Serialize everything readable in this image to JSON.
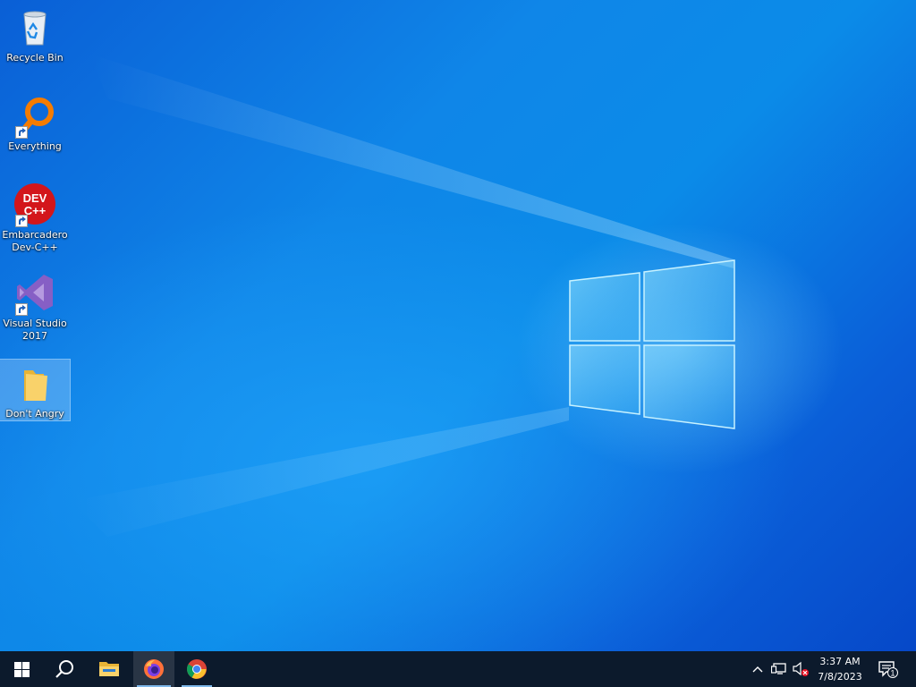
{
  "desktop": {
    "icons": [
      {
        "label": "Recycle Bin",
        "icon": "recycle-bin-icon"
      },
      {
        "label": "Everything",
        "icon": "everything-search-icon"
      },
      {
        "label": "Embarcadero\nDev-C++",
        "icon": "dev-cpp-icon",
        "badge_text": "DEV\nC++"
      },
      {
        "label": "Visual Studio\n2017",
        "icon": "visual-studio-icon"
      },
      {
        "label": "Don't Angry",
        "icon": "folder-icon"
      }
    ]
  },
  "taskbar": {
    "start": "start-icon",
    "search": "search-icon",
    "apps": [
      {
        "name": "File Explorer",
        "icon": "file-explorer-icon"
      },
      {
        "name": "Firefox",
        "icon": "firefox-icon"
      },
      {
        "name": "Chrome",
        "icon": "chrome-icon"
      }
    ],
    "tray": {
      "time": "3:37 AM",
      "date": "7/8/2023",
      "notification_count": "1"
    }
  },
  "colors": {
    "taskbar_bg": "#0c1a2c",
    "accent": "#7fb8ea",
    "wallpaper": "#0b8be8"
  }
}
